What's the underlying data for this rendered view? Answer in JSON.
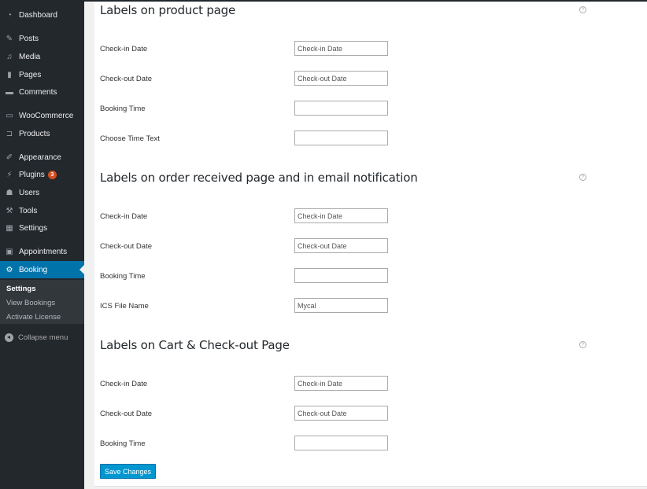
{
  "sidebar": {
    "items": [
      {
        "label": "Dashboard",
        "icon": "dashboard-icon"
      },
      {
        "label": "Posts",
        "icon": "pin-icon"
      },
      {
        "label": "Media",
        "icon": "media-icon"
      },
      {
        "label": "Pages",
        "icon": "pages-icon"
      },
      {
        "label": "Comments",
        "icon": "comment-icon"
      },
      {
        "label": "WooCommerce",
        "icon": "woocommerce-icon"
      },
      {
        "label": "Products",
        "icon": "cart-icon"
      },
      {
        "label": "Appearance",
        "icon": "brush-icon"
      },
      {
        "label": "Plugins",
        "icon": "plugin-icon",
        "badge": "3"
      },
      {
        "label": "Users",
        "icon": "user-icon"
      },
      {
        "label": "Tools",
        "icon": "wrench-icon"
      },
      {
        "label": "Settings",
        "icon": "settings-icon"
      },
      {
        "label": "Appointments",
        "icon": "appointments-icon"
      },
      {
        "label": "Booking",
        "icon": "gear-icon",
        "active": true
      }
    ],
    "submenu": [
      {
        "label": "Settings",
        "current": true
      },
      {
        "label": "View Bookings"
      },
      {
        "label": "Activate License"
      }
    ],
    "collapse_label": "Collapse menu"
  },
  "sections": [
    {
      "title": "Labels on product page",
      "fields": [
        {
          "label": "Check-in Date",
          "value": "Check-in Date"
        },
        {
          "label": "Check-out Date",
          "value": "Check-out Date"
        },
        {
          "label": "Booking Time",
          "value": ""
        },
        {
          "label": "Choose Time Text",
          "value": ""
        }
      ]
    },
    {
      "title": "Labels on order received page and in email notification",
      "fields": [
        {
          "label": "Check-in Date",
          "value": "Check-in Date"
        },
        {
          "label": "Check-out Date",
          "value": "Check-out Date"
        },
        {
          "label": "Booking Time",
          "value": ""
        },
        {
          "label": "ICS File Name",
          "value": "Mycal"
        }
      ]
    },
    {
      "title": "Labels on Cart & Check-out Page",
      "fields": [
        {
          "label": "Check-in Date",
          "value": "Check-in Date"
        },
        {
          "label": "Check-out Date",
          "value": "Check-out Date"
        },
        {
          "label": "Booking Time",
          "value": ""
        }
      ]
    }
  ],
  "help_glyph": "?",
  "save_label": "Save Changes",
  "colors": {
    "accent": "#0073aa",
    "button": "#0097d0",
    "sidebar": "#23282d",
    "badge": "#d54e21"
  }
}
